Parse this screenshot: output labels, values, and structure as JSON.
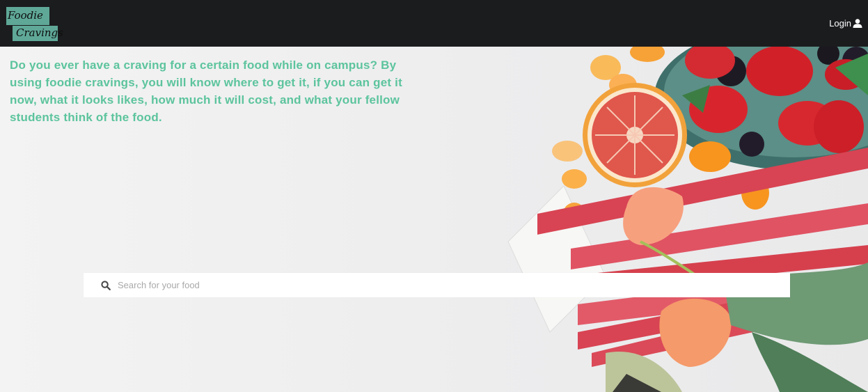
{
  "header": {
    "logo_line1": "Foodie",
    "logo_line2": "Cravings",
    "login_label": "Login",
    "login_icon": "user-icon"
  },
  "hero": {
    "intro": "Do you ever have a craving for a certain food while on campus? By using foodie cravings, you will know where to get it, if you can get it now, what it looks likes, how much it will cost, and what your fellow students think of the food."
  },
  "search": {
    "icon": "search-icon",
    "placeholder": "Search for your food",
    "value": ""
  },
  "colors": {
    "navbar": "#1b1c1e",
    "accent_text": "#5cc49d",
    "logo_bg": "#5fa898"
  }
}
